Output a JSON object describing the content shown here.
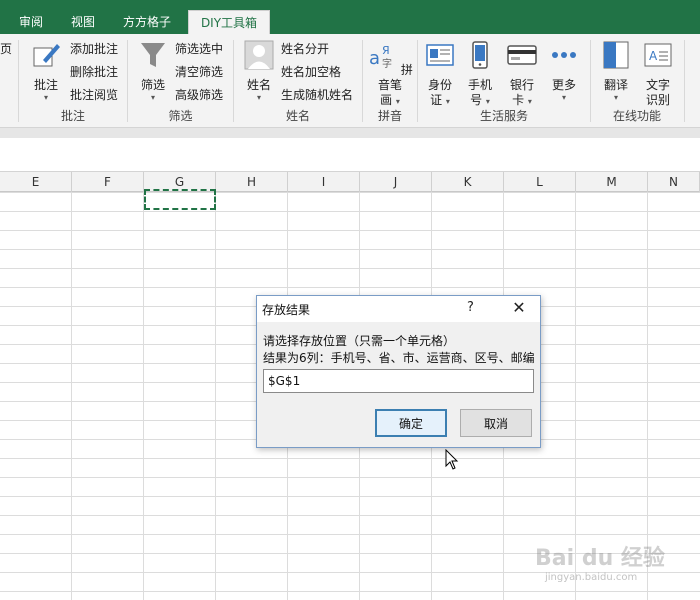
{
  "tabs": [
    {
      "label": "审阅",
      "active": false
    },
    {
      "label": "视图",
      "active": false
    },
    {
      "label": "方方格子",
      "active": false
    },
    {
      "label": "DIY工具箱",
      "active": true
    }
  ],
  "ribbon": {
    "partial_page_label": "页",
    "comment": {
      "big": "批注",
      "items": [
        "添加批注",
        "删除批注",
        "批注阅览"
      ],
      "group": "批注"
    },
    "filter": {
      "big": "筛选",
      "items": [
        "筛选选中",
        "清空筛选",
        "高级筛选"
      ],
      "group": "筛选"
    },
    "name": {
      "big": "姓名",
      "items": [
        "姓名分开",
        "姓名加空格",
        "生成随机姓名"
      ],
      "group": "姓名"
    },
    "pinyin": {
      "big_line1": "拼音笔",
      "big_line2": "画",
      "group": "拼音"
    },
    "life": {
      "buttons": [
        {
          "line1": "身份",
          "line2": "证"
        },
        {
          "line1": "手机",
          "line2": "号"
        },
        {
          "line1": "银行",
          "line2": "卡"
        },
        {
          "line1": "更多",
          "line2": ""
        }
      ],
      "group": "生活服务"
    },
    "online": {
      "buttons": [
        {
          "line1": "翻译",
          "line2": ""
        },
        {
          "line1": "文字",
          "line2": "识别"
        }
      ],
      "group": "在线功能"
    }
  },
  "columns": [
    "E",
    "F",
    "G",
    "H",
    "I",
    "J",
    "K",
    "L",
    "M",
    "N"
  ],
  "dialog": {
    "title": "存放结果",
    "help": "?",
    "close": "✕",
    "line1": "请选择存放位置（只需一个单元格）",
    "line2": "结果为6列：手机号、省、市、运营商、区号、邮编",
    "input_value": "$G$1",
    "ok_label": "确定",
    "cancel_label": "取消"
  },
  "watermark": {
    "brand": "Bai du 经验",
    "sub": "jingyan.baidu.com"
  },
  "colors": {
    "accent": "#217346",
    "dialog_border": "#7a9cc6"
  }
}
